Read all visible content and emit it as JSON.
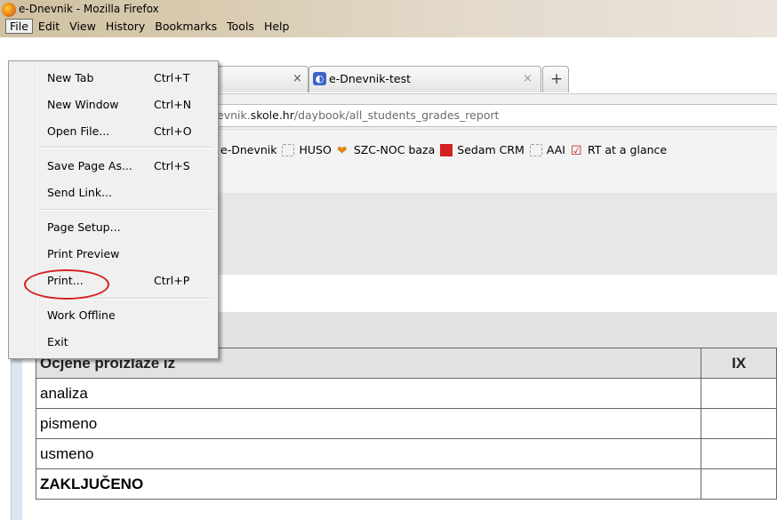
{
  "window": {
    "title": "e-Dnevnik - Mozilla Firefox"
  },
  "menubar": {
    "file": "File",
    "edit": "Edit",
    "view": "View",
    "history": "History",
    "bookmarks": "Bookmarks",
    "tools": "Tools",
    "help": "Help"
  },
  "tabs": {
    "tab1_close": "×",
    "tab2": {
      "label": "e-Dnevnik-test",
      "close": "×"
    },
    "new_tab": "+"
  },
  "url": {
    "prefix": "evnik.",
    "domain": "skole.hr",
    "path": "/daybook/all_students_grades_report"
  },
  "bookmarks": [
    "e-Dnevnik",
    "HUSO",
    "SZC-NOC baza",
    "Sedam CRM",
    "AAI",
    "RT at a glance"
  ],
  "file_menu": [
    {
      "label": "New Tab",
      "shortcut": "Ctrl+T"
    },
    {
      "label": "New Window",
      "shortcut": "Ctrl+N"
    },
    {
      "label": "Open File...",
      "shortcut": "Ctrl+O"
    },
    {
      "label": "Save Page As...",
      "shortcut": "Ctrl+S"
    },
    {
      "label": "Send Link...",
      "shortcut": ""
    },
    {
      "label": "Page Setup...",
      "shortcut": ""
    },
    {
      "label": "Print Preview",
      "shortcut": ""
    },
    {
      "label": "Print...",
      "shortcut": "Ctrl+P"
    },
    {
      "label": "Work Offline",
      "shortcut": ""
    },
    {
      "label": "Exit",
      "shortcut": ""
    }
  ],
  "grades_table": {
    "header": [
      "Ocjene proizlaze iz",
      "IX"
    ],
    "rows": [
      "analiza",
      "pismeno",
      "usmeno",
      "ZAKLJUČENO"
    ]
  },
  "colors": {
    "annotation_circle": "#d42020",
    "title_bar": "#d9ccb2"
  }
}
